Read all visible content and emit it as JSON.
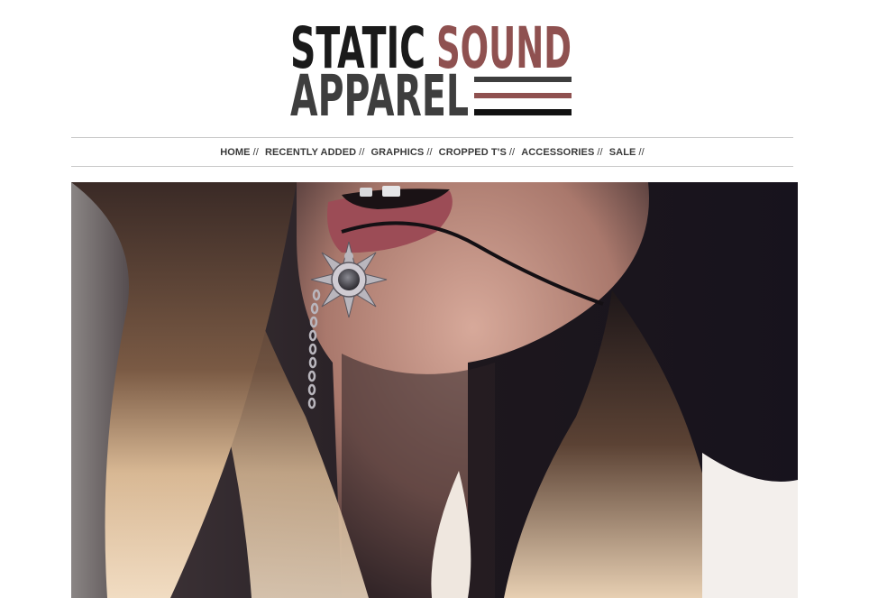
{
  "logo": {
    "line1_word1": "STATIC",
    "line1_word2": "SOUND",
    "line2": "APPAREL",
    "colors": {
      "dark": "#1a1a1a",
      "grey": "#3e3e3e",
      "accent": "#8f5150"
    }
  },
  "nav": {
    "separator": "//",
    "items": [
      {
        "label": "HOME"
      },
      {
        "label": "RECENTLY ADDED"
      },
      {
        "label": "GRAPHICS"
      },
      {
        "label": "CROPPED T'S"
      },
      {
        "label": "ACCESSORIES"
      },
      {
        "label": "SALE"
      }
    ]
  },
  "hero": {
    "image_name": "hero-photo-sun-necklace",
    "colors": {
      "dark_bg": "#1c1621",
      "hair_light": "#e6c9a6",
      "skin": "#c79a8c",
      "lips": "#9c4c56"
    }
  }
}
